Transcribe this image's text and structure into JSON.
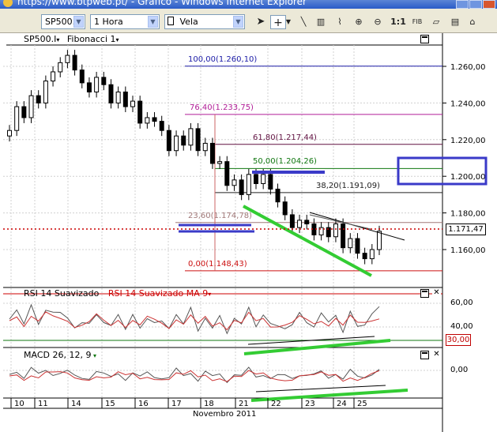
{
  "window": {
    "title": "https://www.btpweb.pt/ - Gráfico - Windows Internet Explorer"
  },
  "toolbar": {
    "symbol": "SP500.I",
    "period": "1 Hora",
    "chart_type": "Vela",
    "ratio_label": "1:1",
    "fib_label": "FIB"
  },
  "price_panel": {
    "header_symbol": "SP500.I",
    "header_study": "Fibonacci 1",
    "current_price": "1.171,47",
    "price_ticks": [
      "1.260,00",
      "1.240,00",
      "1.220,00",
      "1.200,00",
      "1.180,00",
      "1.160,00"
    ],
    "fib_levels": [
      {
        "label": "100,00(1.260,10)",
        "color": "#1a1aa6"
      },
      {
        "label": "76,40(1.233,75)",
        "color": "#b01c96"
      },
      {
        "label": "61,80(1.217,44)",
        "color": "#601040"
      },
      {
        "label": "50,00(1.204,26)",
        "color": "#117711"
      },
      {
        "label": "38,20(1.191,09)",
        "color": "#222222"
      },
      {
        "label": "23,60(1.174,78)",
        "color": "#a07878"
      },
      {
        "label": "0,00(1.148,43)",
        "color": "#cc1111"
      }
    ]
  },
  "rsi_panel": {
    "label1": "RSI 14 Suavizado",
    "label2": "RSI 14 Suavizado MA 9",
    "ticks": [
      "60,00",
      "40,00"
    ],
    "current": "30,00"
  },
  "macd_panel": {
    "label": "MACD 26, 12, 9",
    "ticks": [
      "0,00"
    ]
  },
  "time_axis": {
    "days": [
      "10",
      "11",
      "14",
      "15",
      "16",
      "17",
      "18",
      "21",
      "22",
      "23",
      "24",
      "25"
    ],
    "month": "Novembro 2011"
  },
  "colors": {
    "accent_blue": "#3a3ac8",
    "green_trend": "#33cc33",
    "price_dotted": "#cc0000"
  },
  "chart_data": {
    "type": "candlestick",
    "title": "",
    "series_name": "SP500.I",
    "y_range": [
      1140,
      1272
    ],
    "closes_approx": [
      1225,
      1238,
      1232,
      1244,
      1240,
      1252,
      1257,
      1262,
      1266,
      1258,
      1251,
      1246,
      1254,
      1250,
      1240,
      1246,
      1238,
      1241,
      1229,
      1232,
      1230,
      1225,
      1214,
      1222,
      1217,
      1226,
      1214,
      1218,
      1207,
      1208,
      1195,
      1198,
      1190,
      1201,
      1196,
      1201,
      1193,
      1186,
      1179,
      1172,
      1176,
      1174,
      1168,
      1172,
      1167,
      1174,
      1161,
      1166,
      1158,
      1155,
      1160,
      1170
    ]
  }
}
